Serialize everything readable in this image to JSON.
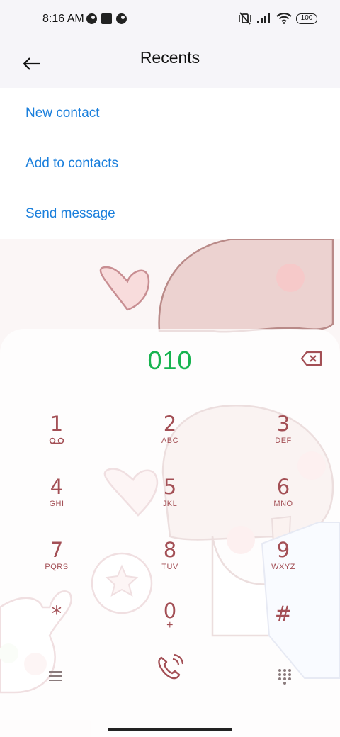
{
  "status_bar": {
    "time": "8:16 AM",
    "battery": "100",
    "icons": [
      "notification-circle-icon",
      "square-app-icon",
      "notification-circle-icon",
      "vibrate-mute-icon",
      "signal-icon",
      "wifi-icon",
      "battery-icon"
    ]
  },
  "header": {
    "title": "Recents",
    "back_icon": "arrow-left-icon"
  },
  "actions": {
    "new_contact": "New contact",
    "add_to_contacts": "Add to contacts",
    "send_message": "Send message"
  },
  "dialer": {
    "number": "010",
    "backspace_icon": "backspace-icon",
    "keys": [
      {
        "digit": "1",
        "letters": "voicemail"
      },
      {
        "digit": "2",
        "letters": "ABC"
      },
      {
        "digit": "3",
        "letters": "DEF"
      },
      {
        "digit": "4",
        "letters": "GHI"
      },
      {
        "digit": "5",
        "letters": "JKL"
      },
      {
        "digit": "6",
        "letters": "MNO"
      },
      {
        "digit": "7",
        "letters": "PQRS"
      },
      {
        "digit": "8",
        "letters": "TUV"
      },
      {
        "digit": "9",
        "letters": "WXYZ"
      },
      {
        "digit": "*",
        "letters": ""
      },
      {
        "digit": "0",
        "letters": "+"
      },
      {
        "digit": "#",
        "letters": ""
      }
    ],
    "bottom": {
      "menu_icon": "menu-icon",
      "call_icon": "phone-call-icon",
      "keypad_icon": "keypad-grid-icon"
    },
    "colors": {
      "number": "#17b34f",
      "keys": "#a34f55",
      "links": "#1a7fdc"
    }
  }
}
